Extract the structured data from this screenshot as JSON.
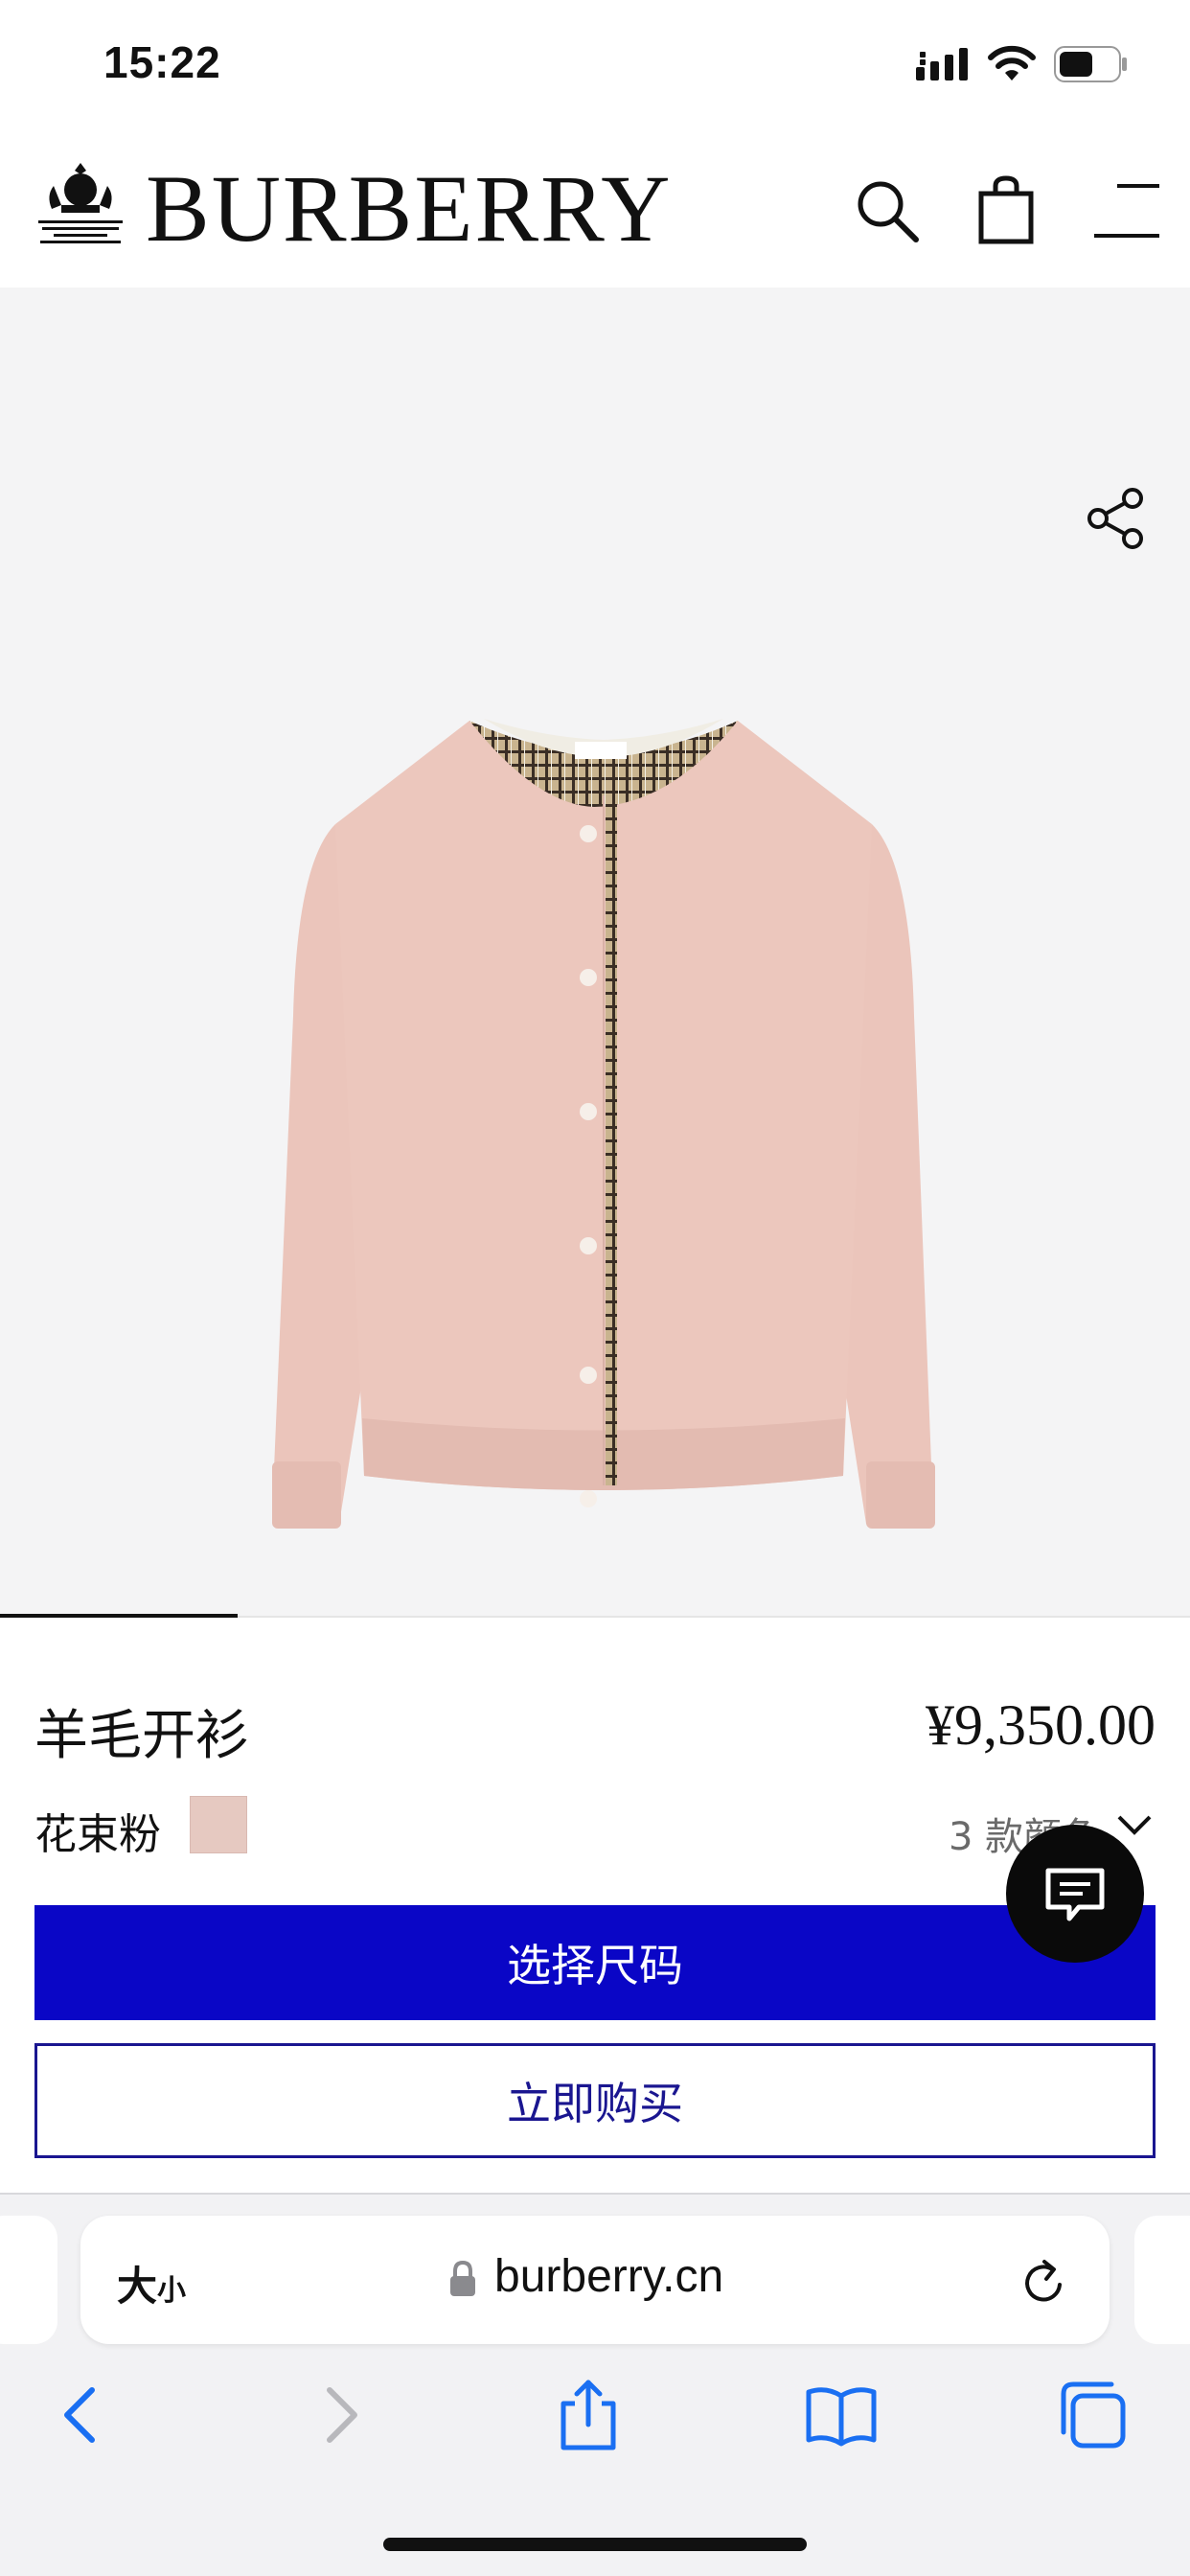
{
  "status_bar": {
    "time": "15:22",
    "icons": [
      "cellular-signal-icon",
      "wifi-icon",
      "battery-icon"
    ]
  },
  "header": {
    "brand": "BURBERRY",
    "icons": [
      "royal-warrant-crest-icon",
      "search-icon",
      "shopping-bag-icon",
      "menu-icon"
    ]
  },
  "product": {
    "title": "羊毛开衫",
    "price": "¥9,350.00",
    "color_name": "花束粉",
    "swatch_color": "#e6c9c1",
    "colors_available": "3 款颜色",
    "primary_button": "选择尺码",
    "secondary_button": "立即购买",
    "image_count_progress": 0.2
  },
  "safari": {
    "text_size_label_big": "大",
    "text_size_label_small": "小",
    "url": "burberry.cn",
    "toolbar_icons": [
      "back-icon",
      "forward-icon",
      "share-icon",
      "bookmarks-icon",
      "tabs-icon"
    ]
  },
  "colors": {
    "accent_blue": "#0a06c6",
    "outline_blue": "#1a1690",
    "hero_bg": "#f4f4f5",
    "garment_pink": "#ecc7bd"
  }
}
